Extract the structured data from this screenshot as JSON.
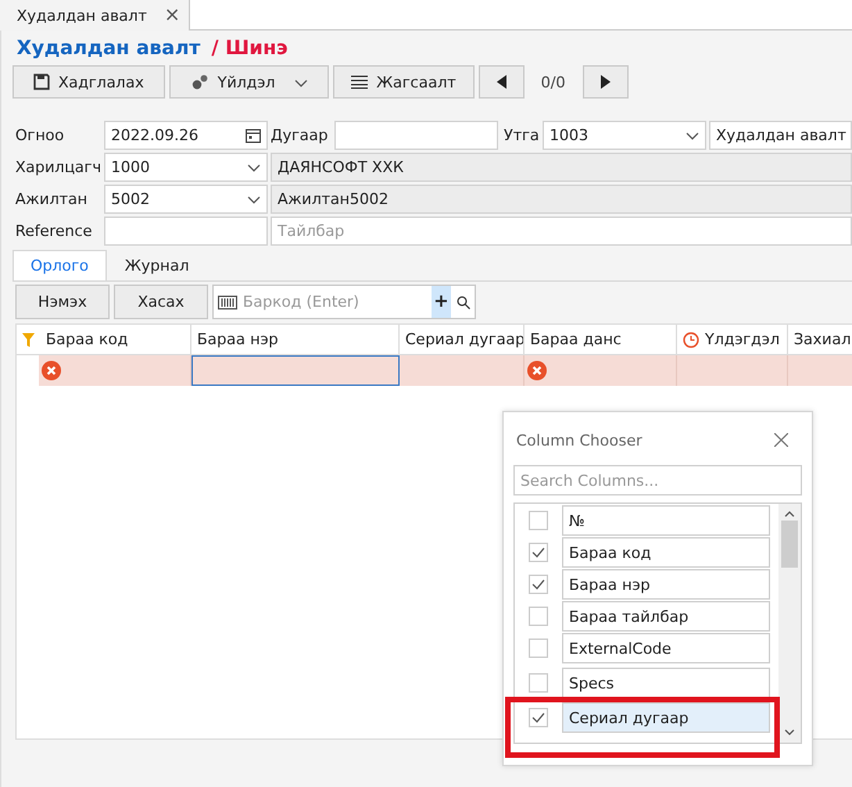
{
  "doc_tab": {
    "label": "Худалдан авалт",
    "close": "×"
  },
  "title": {
    "name": "Худалдан авалт",
    "status": "/ Шинэ"
  },
  "toolbar": [
    {
      "kind": "save",
      "label": "Хадглалах"
    },
    {
      "kind": "actions",
      "label": "Үйлдэл"
    },
    {
      "kind": "list",
      "label": "Жагсаалт"
    },
    {
      "kind": "prev"
    },
    {
      "kind": "counter",
      "label": "0/0"
    },
    {
      "kind": "next"
    }
  ],
  "form": {
    "date_label": "Огноо",
    "date": "2022.09.26",
    "number_label": "Дугаар",
    "memo_label": "Утга",
    "memo_code": "1003",
    "memo_text": "Худалдан авалт",
    "partner_label": "Харилцагч",
    "partner_code": "1000",
    "partner_name": "ДАЯНСОФТ ХХК",
    "employee_label": "Ажилтан",
    "employee_code": "5002",
    "employee_name": "Ажилтан5002",
    "reference_label": "Reference",
    "description_placeholder": "Тайлбар"
  },
  "tabs": [
    {
      "label": "Орлого",
      "selected": true
    },
    {
      "label": "Журнал",
      "selected": false
    }
  ],
  "grid_toolbar": {
    "add": "Нэмэх",
    "remove": "Хасах",
    "barcode_placeholder": "Баркод (Enter)",
    "plus": "+"
  },
  "columns": [
    {
      "label": "Бараа код",
      "kind": "filter"
    },
    {
      "label": "Бараа нэр"
    },
    {
      "label": "Сериал дугаар"
    },
    {
      "label": "Бараа данс"
    },
    {
      "label": "Үлдэгдэл",
      "kind": "clock"
    },
    {
      "label": "Захиал"
    }
  ],
  "row": [
    {
      "error": true,
      "focused": false
    },
    {
      "error": false,
      "focused": true
    },
    {
      "error": false,
      "focused": false
    },
    {
      "error": true,
      "focused": false
    },
    {
      "error": false,
      "focused": false
    },
    {
      "error": false,
      "focused": false
    }
  ],
  "chooser": {
    "title": "Column Chooser",
    "search_placeholder": "Search Columns...",
    "items": [
      {
        "label": "№",
        "checked": false,
        "selected": false
      },
      {
        "label": "Бараа код",
        "checked": true,
        "selected": false
      },
      {
        "label": "Бараа нэр",
        "checked": true,
        "selected": false
      },
      {
        "label": "Бараа тайлбар",
        "checked": false,
        "selected": false
      },
      {
        "label": "ExternalCode",
        "checked": false,
        "selected": false
      },
      {
        "label": "Specs",
        "checked": false,
        "selected": false
      },
      {
        "label": "Сериал дугаар",
        "checked": true,
        "selected": true
      }
    ]
  }
}
